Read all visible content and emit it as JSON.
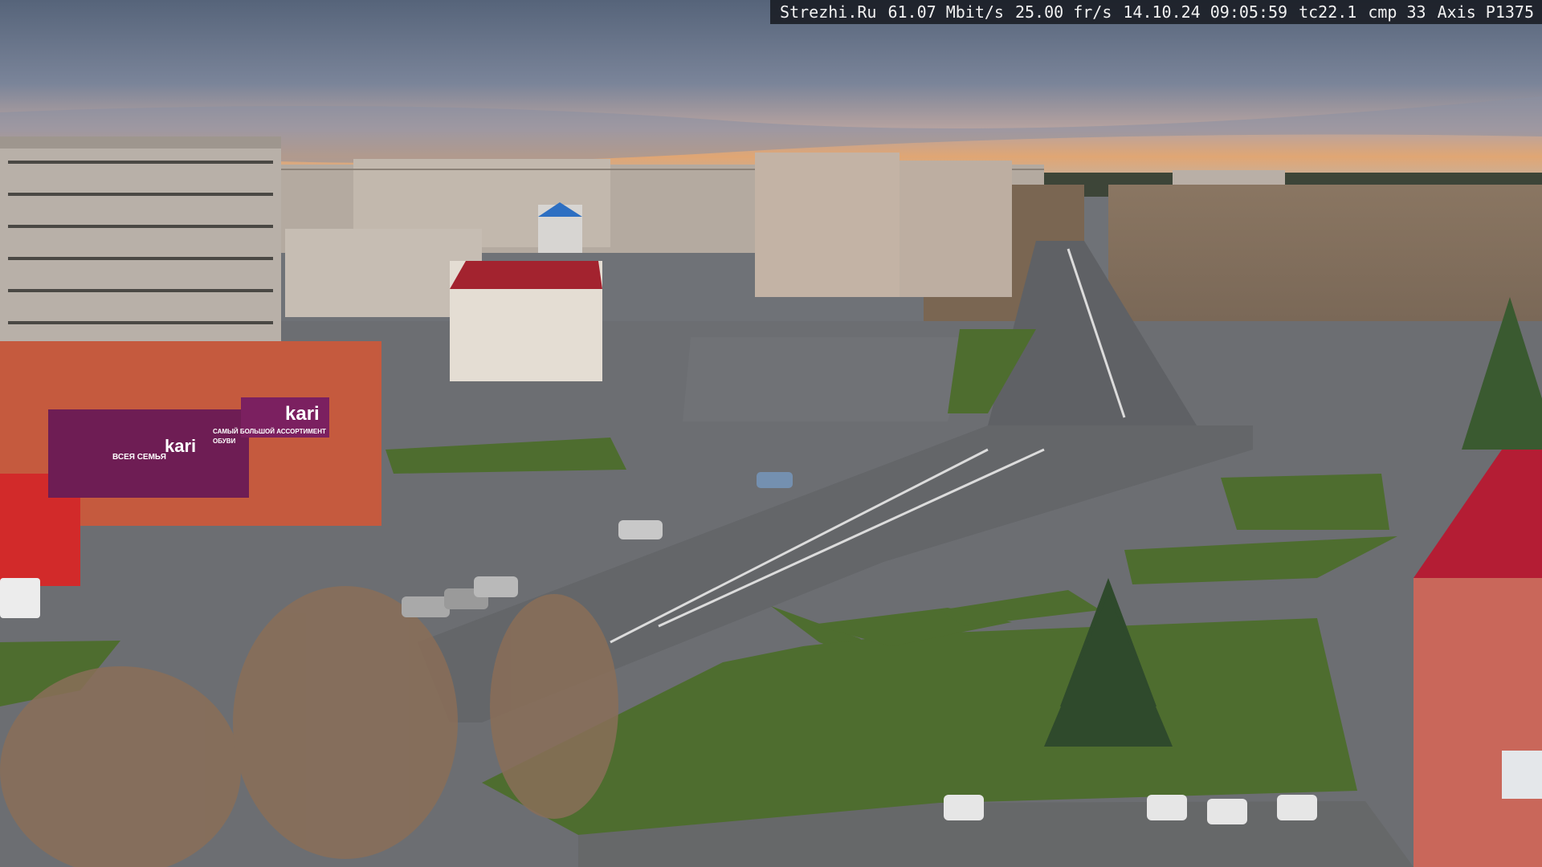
{
  "overlay": {
    "site": "Strezhi.Ru",
    "bitrate": "61.07 Mbit/s",
    "framerate": "25.00 fr/s",
    "datetime": "14.10.24 09:05:59",
    "tc": "tc22.1",
    "cmp": "cmp 33",
    "camera": "Axis P1375"
  },
  "store_sign": {
    "brand": "kari",
    "text1": "ВСЕЯ СЕМЬЯ",
    "text2": "САМЫЙ БОЛЬШОЙ АССОРТИМЕНТ",
    "text3": "ОБУВИ"
  },
  "colors": {
    "sky_top": "#5d6a80",
    "sky_glow": "#e0a070",
    "asphalt": "#6c6e72",
    "grass": "#4c6b2e",
    "brick": "#c8593e",
    "kari_purple": "#7a1f5e",
    "roof_red": "#b02030"
  }
}
